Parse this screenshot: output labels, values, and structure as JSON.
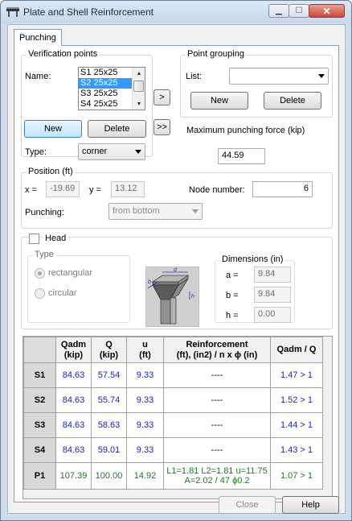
{
  "window": {
    "title": "Plate and Shell Reinforcement"
  },
  "tab": {
    "label": "Punching"
  },
  "verification": {
    "legend": "Verification points",
    "name_label": "Name:",
    "items": [
      "S1 25x25",
      "S2 25x25",
      "S3 25x25",
      "S4 25x25"
    ],
    "selected_index": 1,
    "new_label": "New",
    "delete_label": "Delete",
    "type_label": "Type:",
    "type_value": "corner"
  },
  "move": {
    "right_label": ">",
    "all_label": ">>"
  },
  "grouping": {
    "legend": "Point grouping",
    "list_label": "List:",
    "list_value": "",
    "new_label": "New",
    "delete_label": "Delete"
  },
  "max_force": {
    "label": "Maximum punching force (kip)",
    "value": "44.59"
  },
  "position": {
    "legend": "Position (ft)",
    "x_label": "x =",
    "x_value": "-19.69",
    "y_label": "y =",
    "y_value": "13.12",
    "node_label": "Node number:",
    "node_value": "6",
    "punching_label": "Punching:",
    "punching_value": "from bottom"
  },
  "head": {
    "label": "Head",
    "checked": false,
    "type_legend": "Type",
    "rect_label": "rectangular",
    "circ_label": "circular",
    "dims_legend": "Dimensions (in)",
    "a_label": "a =",
    "a_value": "9.84",
    "b_label": "b =",
    "b_value": "9.84",
    "h_label": "h =",
    "h_value": "0.00",
    "diagram": {
      "d": "d",
      "b": "b",
      "h": "h"
    }
  },
  "results": {
    "headers": [
      {
        "l1": "Qadm",
        "l2": "(kip)"
      },
      {
        "l1": "Q",
        "l2": "(kip)"
      },
      {
        "l1": "u",
        "l2": "(ft)"
      },
      {
        "l1": "Reinforcement",
        "l2": "(ft), (in2) / n x ϕ (in)"
      },
      {
        "l1": "Qadm / Q",
        "l2": ""
      }
    ],
    "rows": [
      {
        "name": "S1",
        "qadm": "84.63",
        "q": "57.54",
        "u": "9.33",
        "reinf1": "----",
        "reinf2": "",
        "ratio": "1.47 > 1"
      },
      {
        "name": "S2",
        "qadm": "84.63",
        "q": "55.74",
        "u": "9.33",
        "reinf1": "----",
        "reinf2": "",
        "ratio": "1.52 > 1"
      },
      {
        "name": "S3",
        "qadm": "84.63",
        "q": "58.63",
        "u": "9.33",
        "reinf1": "----",
        "reinf2": "",
        "ratio": "1.44 > 1"
      },
      {
        "name": "S4",
        "qadm": "84.63",
        "q": "59.01",
        "u": "9.33",
        "reinf1": "----",
        "reinf2": "",
        "ratio": "1.43 > 1"
      },
      {
        "name": "P1",
        "qadm": "107.39",
        "q": "100.00",
        "u": "14.92",
        "reinf1": "L1=1.81 L2=1.81 u=11.75",
        "reinf2": "A=2.02 / 47 ϕ0.2",
        "ratio": "1.07 > 1"
      }
    ]
  },
  "footer": {
    "close_label": "Close",
    "help_label": "Help"
  },
  "colors": {
    "value_blue": "#2020c0",
    "value_green": "#1a7a1a",
    "selection": "#3399ff"
  }
}
